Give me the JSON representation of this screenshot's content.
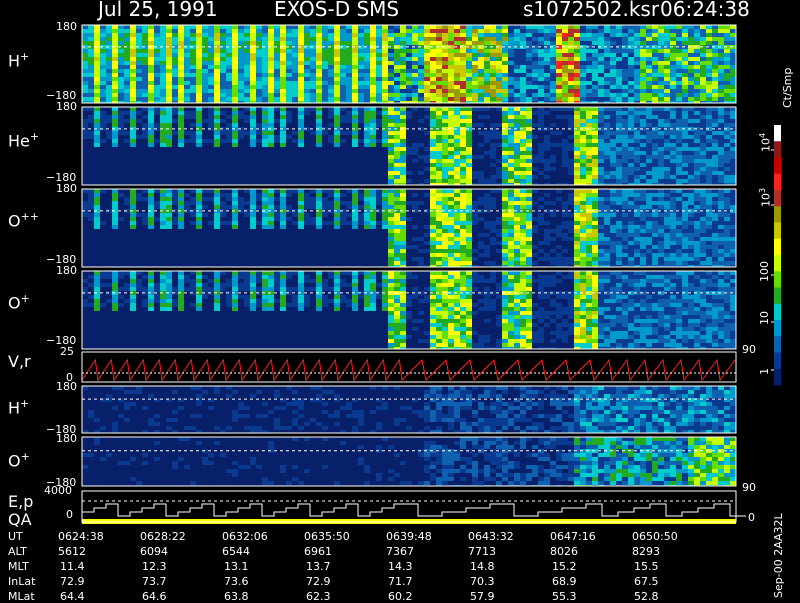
{
  "header": {
    "date": "Jul 25, 1991",
    "title": "EXOS-D SMS",
    "file": "s1072502.ksr",
    "time": "06:24:38"
  },
  "panels": [
    {
      "label": "H",
      "sup": "+",
      "y_top": "180",
      "y_bot": "−180"
    },
    {
      "label": "He",
      "sup": "+",
      "y_top": "180",
      "y_bot": "−180"
    },
    {
      "label": "O",
      "sup": "++",
      "y_top": "180",
      "y_bot": "−180"
    },
    {
      "label": "O",
      "sup": "+",
      "y_top": "180",
      "y_bot": "−180"
    },
    {
      "label": "V,r",
      "sup": "",
      "y_top": "25",
      "y_bot": "0",
      "right": "90"
    },
    {
      "label": "H",
      "sup": "+",
      "y_top": "180",
      "y_bot": "−180"
    },
    {
      "label": "O",
      "sup": "+",
      "y_top": "180",
      "y_bot": "−180",
      "right": "90"
    },
    {
      "label": "E,p",
      "label2": "QA",
      "y_top": "4000",
      "y_bot": "0",
      "right": "0"
    }
  ],
  "colorbar": {
    "unit": "Ct/Smp",
    "ticks": [
      {
        "base": "10",
        "exp": "4"
      },
      {
        "base": "10",
        "exp": "3"
      },
      {
        "base": "100",
        "exp": ""
      },
      {
        "base": "10",
        "exp": ""
      },
      {
        "base": "1",
        "exp": ""
      }
    ],
    "colors": [
      "#ffffff",
      "#8b1a1a",
      "#c80000",
      "#ff2020",
      "#b03030",
      "#9a9a00",
      "#c8c800",
      "#ffff00",
      "#c8ff00",
      "#66dd00",
      "#22aa22",
      "#00cccc",
      "#0099cc",
      "#1060b0",
      "#0a3a90",
      "#08206a"
    ]
  },
  "credit": "Sep-00  2AA32L",
  "chart_data": {
    "type": "heatmap",
    "title": "Jul 25, 1991  EXOS-D SMS",
    "x_axis": "UT",
    "x": [
      "0624:38",
      "0628:22",
      "0632:06",
      "0635:50",
      "0639:48",
      "0643:32",
      "0647:16",
      "0650:50"
    ],
    "rows": {
      "ALT": [
        "5612",
        "6094",
        "6544",
        "6961",
        "7367",
        "7713",
        "8026",
        "8293"
      ],
      "MLT": [
        "11.4",
        "12.3",
        "13.1",
        "13.7",
        "14.3",
        "14.8",
        "15.2",
        "15.5"
      ],
      "InLat": [
        "72.9",
        "73.7",
        "73.6",
        "72.9",
        "71.7",
        "70.3",
        "68.9",
        "67.5"
      ],
      "MLat": [
        "64.4",
        "64.6",
        "63.8",
        "62.3",
        "60.2",
        "57.9",
        "55.3",
        "52.8"
      ]
    },
    "colorbar_range": [
      "1",
      "10000"
    ],
    "colorbar_unit": "Ct/Smp"
  },
  "table_labels": [
    "UT",
    "ALT",
    "MLT",
    "InLat",
    "MLat"
  ]
}
